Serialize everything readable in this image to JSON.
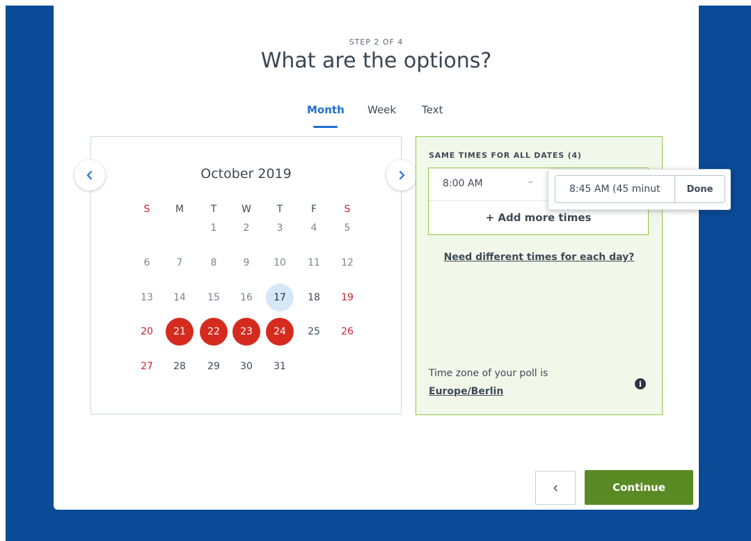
{
  "header": {
    "step": "STEP 2 OF 4",
    "title": "What are the options?"
  },
  "tabs": [
    {
      "label": "Month",
      "active": true
    },
    {
      "label": "Week",
      "active": false
    },
    {
      "label": "Text",
      "active": false
    }
  ],
  "calendar": {
    "month_label": "October 2019",
    "weekdays": [
      "S",
      "M",
      "T",
      "W",
      "T",
      "F",
      "S"
    ],
    "weeks": [
      [
        "",
        "",
        "1",
        "2",
        "3",
        "4",
        "5"
      ],
      [
        "6",
        "7",
        "8",
        "9",
        "10",
        "11",
        "12"
      ],
      [
        "13",
        "14",
        "15",
        "16",
        "17",
        "18",
        "19"
      ],
      [
        "20",
        "21",
        "22",
        "23",
        "24",
        "25",
        "26"
      ],
      [
        "27",
        "28",
        "29",
        "30",
        "31",
        "",
        ""
      ]
    ],
    "today": "17",
    "selected": [
      "21",
      "22",
      "23",
      "24"
    ],
    "past_until": 16,
    "prev_icon": "chevron-left-icon",
    "next_icon": "chevron-right-icon"
  },
  "times_panel": {
    "heading": "SAME TIMES FOR ALL DATES (4)",
    "start_time": "8:00 AM",
    "dash": "–",
    "add_more": "+ Add more times",
    "different_times_link": "Need different times for each day?",
    "timezone_label": "Time zone of your poll is",
    "timezone_value": "Europe/Berlin",
    "info_icon": "info-icon"
  },
  "popover": {
    "end_time_value": "8:45 AM (45 minut",
    "done_label": "Done"
  },
  "footer": {
    "back_icon": "chevron-left-icon",
    "continue_label": "Continue"
  },
  "colors": {
    "background_blue": "#0b4a96",
    "accent_blue": "#1f6fd1",
    "selected_red": "#d52b1e",
    "panel_green": "#8cc542",
    "continue_green": "#5a8a23"
  }
}
